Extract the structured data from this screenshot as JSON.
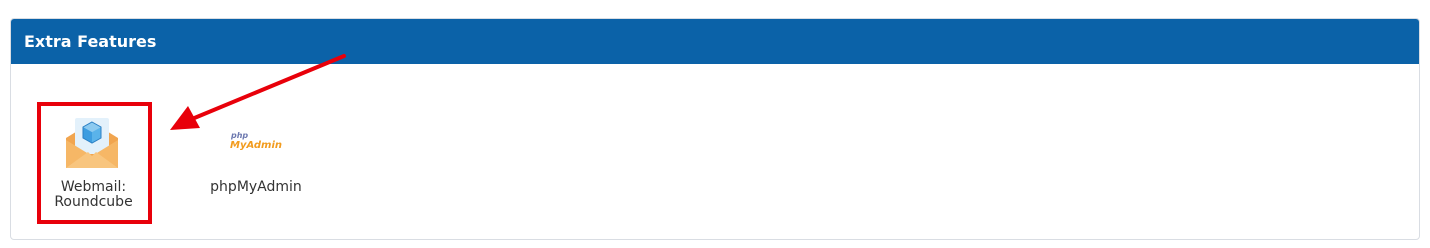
{
  "panel": {
    "title": "Extra Features",
    "header_color": "#0b62a8"
  },
  "features": [
    {
      "label": "Webmail: Roundcube",
      "label_line1": "Webmail:",
      "label_line2": "Roundcube",
      "icon": "roundcube-envelope-icon",
      "highlighted": true
    },
    {
      "label": "phpMyAdmin",
      "icon": "phpmyadmin-logo-icon",
      "logo_top": "php",
      "logo_bottom": "MyAdmin"
    }
  ],
  "annotation": {
    "highlight_color": "#e8000a",
    "arrow_color": "#e8000a"
  }
}
